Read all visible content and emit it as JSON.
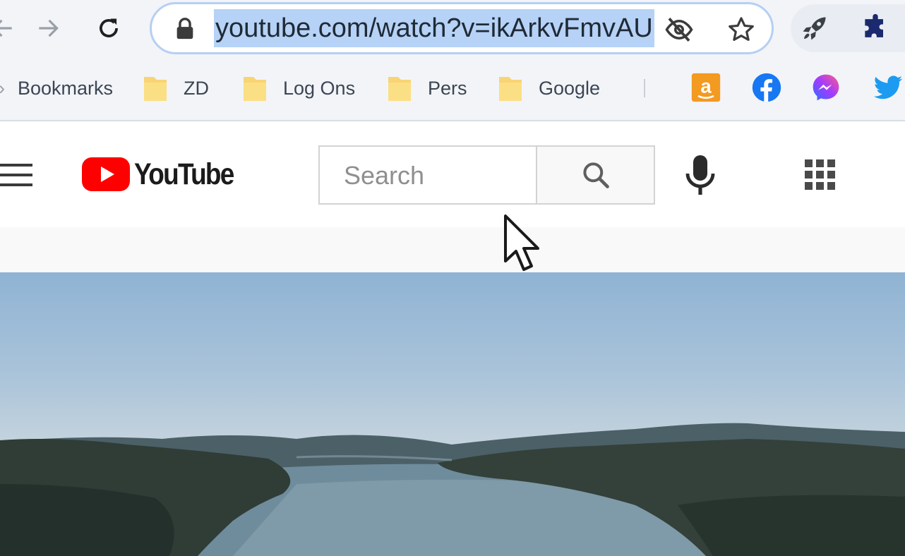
{
  "browser": {
    "url": "youtube.com/watch?v=ikArkvFmvAU",
    "nav_icons": [
      "back-arrow-icon",
      "forward-arrow-icon",
      "reload-icon"
    ],
    "omnibox_icons": [
      "lock-icon",
      "eye-off-icon",
      "star-icon"
    ],
    "extension_icons": [
      "rocket-icon",
      "puzzle-icon"
    ],
    "bookmarks": {
      "label": "Bookmarks",
      "folders": [
        "ZD",
        "Log Ons",
        "Pers",
        "Google"
      ],
      "sites": [
        "amazon-icon",
        "facebook-icon",
        "messenger-icon",
        "twitter-icon"
      ]
    }
  },
  "youtube": {
    "logo_text": "YouTube",
    "search_placeholder": "Search",
    "brand_color": "#ff0000",
    "icons": [
      "menu-icon",
      "search-icon",
      "mic-icon",
      "apps-grid-icon"
    ]
  },
  "video": {
    "scene": "lake-landscape"
  },
  "colors": {
    "omnibox_border": "#b6cff3",
    "url_highlight": "#b6d2f6",
    "chrome_bg": "#f2f4f8"
  }
}
